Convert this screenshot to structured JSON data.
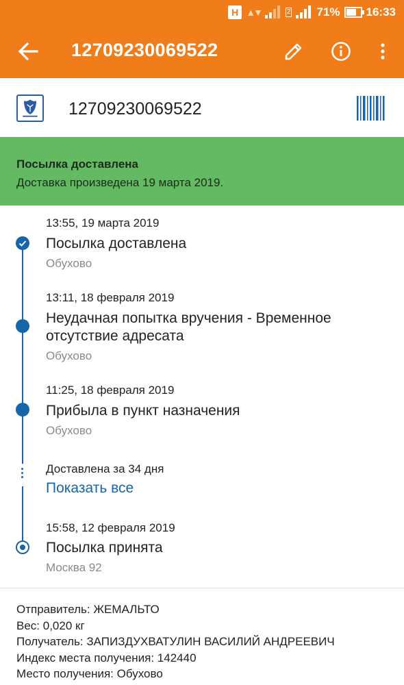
{
  "status_bar": {
    "network_letter": "H",
    "sim_slot": "2",
    "battery": "71%",
    "time": "16:33"
  },
  "app_bar": {
    "title": "12709230069522",
    "icons": [
      "back-arrow-icon",
      "edit-pencil-icon",
      "info-icon",
      "more-vert-icon"
    ]
  },
  "tracking": {
    "number": "12709230069522",
    "carrier_icon": "russian-post-logo",
    "barcode_icon": "barcode-icon"
  },
  "banner": {
    "title": "Посылка доставлена",
    "subtitle": "Доставка произведена 19 марта 2019.",
    "color": "#64ba63"
  },
  "events": [
    {
      "time": "13:55, 19 марта 2019",
      "title": "Посылка доставлена",
      "place": "Обухово"
    },
    {
      "time": "13:11, 18 февраля 2019",
      "title": "Неудачная попытка вручения - Временное отсутствие адресата",
      "place": "Обухово"
    },
    {
      "time": "11:25, 18 февраля 2019",
      "title": "Прибыла в пункт назначения",
      "place": "Обухово"
    }
  ],
  "summary": {
    "text": "Доставлена за 34 дня",
    "show_all": "Показать все"
  },
  "first_event": {
    "time": "15:58, 12 февраля 2019",
    "title": "Посылка принята",
    "place": "Москва 92"
  },
  "details": [
    "Отправитель: ЖЕМАЛЬТО",
    "Вес: 0,020 кг",
    "Получатель: ЗАПИЗДУХВАТУЛИН ВАСИЛИЙ АНДРЕЕВИЧ",
    "Индекс места получения: 142440",
    "Место получения: Обухово"
  ],
  "colors": {
    "accent": "#f07d1a",
    "timeline": "#1565a8",
    "link": "#1565a8"
  }
}
